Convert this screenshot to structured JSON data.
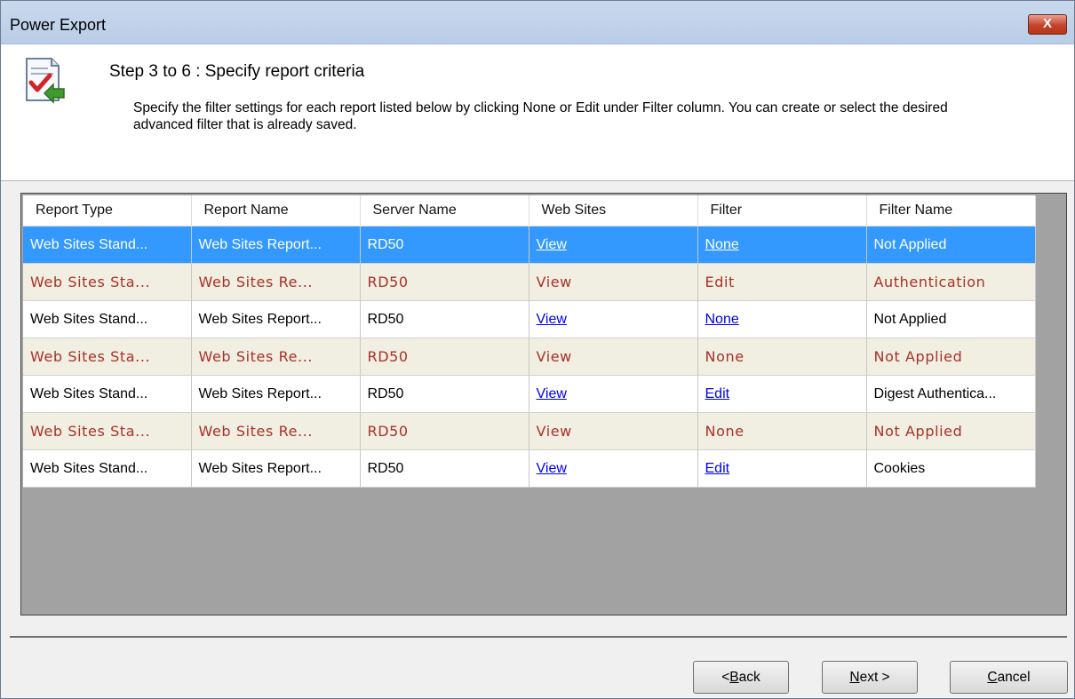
{
  "window": {
    "title": "Power Export",
    "close_label": "X"
  },
  "header": {
    "step_title": "Step 3 to 6 : Specify report criteria",
    "description": "Specify the filter settings for each report listed below by clicking None or Edit under Filter column. You can create or select the desired advanced filter that is already saved."
  },
  "grid": {
    "columns": [
      "Report Type",
      "Report Name",
      "Server Name",
      "Web Sites",
      "Filter",
      "Filter Name"
    ],
    "rows": [
      {
        "report_type": "Web Sites Stand...",
        "report_name": "Web Sites Report...",
        "server": "RD50",
        "web_sites": "View",
        "filter": "None",
        "filter_name": "Not Applied"
      },
      {
        "report_type": "Web Sites Sta...",
        "report_name": "Web Sites Re...",
        "server": "RD50",
        "web_sites": "View",
        "filter": "Edit",
        "filter_name": "Authentication"
      },
      {
        "report_type": "Web Sites Stand...",
        "report_name": "Web Sites Report...",
        "server": "RD50",
        "web_sites": "View",
        "filter": "None",
        "filter_name": "Not Applied"
      },
      {
        "report_type": "Web Sites Sta...",
        "report_name": "Web Sites Re...",
        "server": "RD50",
        "web_sites": "View",
        "filter": "None",
        "filter_name": "Not Applied"
      },
      {
        "report_type": "Web Sites Stand...",
        "report_name": "Web Sites Report...",
        "server": "RD50",
        "web_sites": "View",
        "filter": "Edit",
        "filter_name": "Digest Authentica..."
      },
      {
        "report_type": "Web Sites Sta...",
        "report_name": "Web Sites Re...",
        "server": "RD50",
        "web_sites": "View",
        "filter": "None",
        "filter_name": "Not Applied"
      },
      {
        "report_type": "Web Sites Stand...",
        "report_name": "Web Sites Report...",
        "server": "RD50",
        "web_sites": "View",
        "filter": "Edit",
        "filter_name": "Cookies"
      }
    ]
  },
  "buttons": {
    "back": {
      "mnemonic": "B",
      "rest": "ack",
      "prefix": "<"
    },
    "next": {
      "mnemonic": "N",
      "rest": "ext >",
      "prefix": ""
    },
    "cancel": {
      "mnemonic": "C",
      "rest": "ancel",
      "prefix": ""
    }
  },
  "colors": {
    "selection": "#3399ff",
    "alt_row_bg": "#f1efe1",
    "alt_row_text": "#a8312a",
    "link": "#0000ee"
  }
}
